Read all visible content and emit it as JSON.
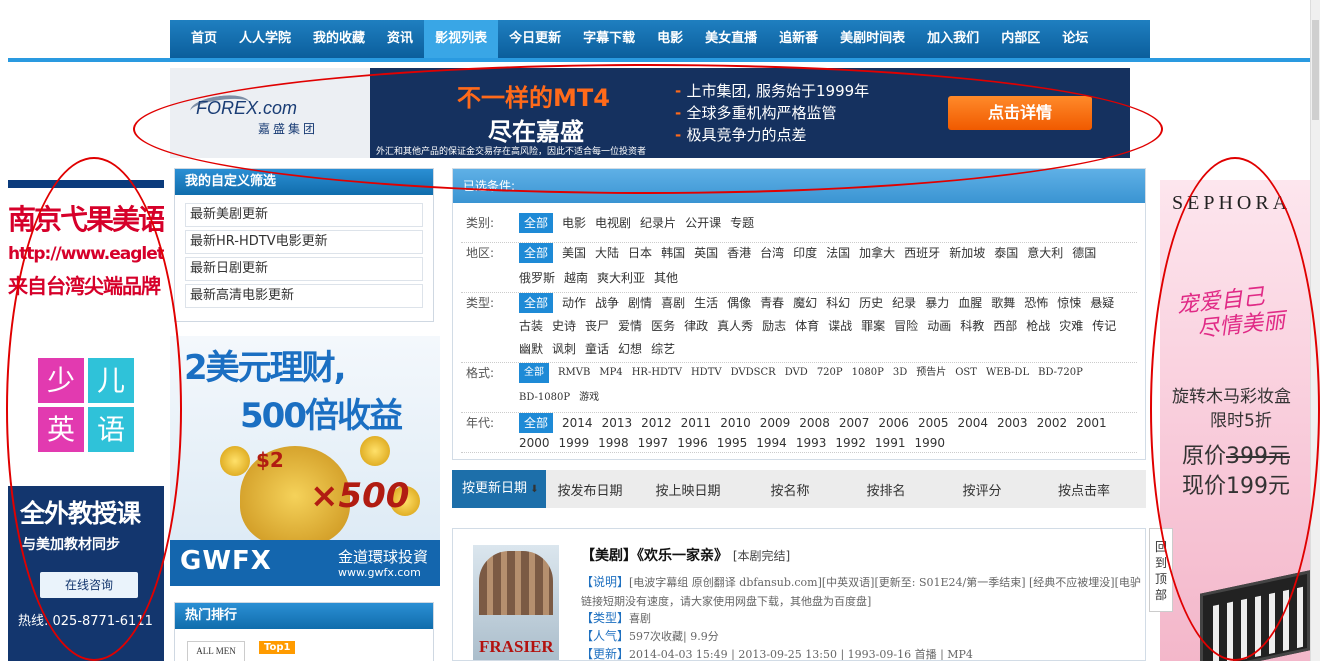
{
  "nav": [
    "首页",
    "人人学院",
    "我的收藏",
    "资讯",
    "影视列表",
    "今日更新",
    "字幕下载",
    "电影",
    "美女直播",
    "追新番",
    "美剧时间表",
    "加入我们",
    "内部区",
    "论坛"
  ],
  "nav_active": "影视列表",
  "forex": {
    "logo": "FOREX",
    "logo_suffix": ".com",
    "logo_sub": "嘉盛集团",
    "headline1": "不一样的MT4",
    "headline2": "尽在嘉盛",
    "bullets": [
      "上市集团, 服务始于1999年",
      "全球多重机构严格监管",
      "极具竞争力的点差"
    ],
    "button": "点击详情",
    "disclaimer": "外汇和其他产品的保证金交易存在高风险，因此不适合每一位投资者"
  },
  "left_ad": {
    "line1": "南京弋果美语",
    "line2": "http://www.eagletw.cn",
    "line3": "来自台湾尖端品牌",
    "chars": [
      "少",
      "儿",
      "英",
      "语"
    ],
    "b1": "全外教授课",
    "b2": "与美加教材同步",
    "b3": "在线咨询",
    "b4": "热线: 025-8771-6111"
  },
  "right_ad": {
    "brand": "SEPHORA",
    "script": [
      "宠爱自己",
      "尽情美丽"
    ],
    "r1": "旋转木马彩妆盒",
    "r2": "限时5折",
    "r3_prefix": "原价",
    "r3_price": "399元",
    "r4": "现价199元"
  },
  "custom": {
    "title": "我的自定义筛选",
    "items": [
      "最新美剧更新",
      "最新HR-HDTV电影更新",
      "最新日剧更新",
      "最新高清电影更新"
    ]
  },
  "mid_ad": {
    "m1": "2美元理财,",
    "m2": "500倍收益",
    "x2": "$2",
    "x500": "×500",
    "brand": "GWFX",
    "cn": "金道環球投資",
    "url": "www.gwfx.com"
  },
  "hot": {
    "title": "热门排行",
    "thumb": "ALL MEN",
    "badge": "Top1"
  },
  "filter": {
    "header": "已选条件:",
    "rows": [
      {
        "label": "类别:",
        "opts": [
          "全部",
          "电影",
          "电视剧",
          "纪录片",
          "公开课",
          "专题"
        ]
      },
      {
        "label": "地区:",
        "opts": [
          "全部",
          "美国",
          "大陆",
          "日本",
          "韩国",
          "英国",
          "香港",
          "台湾",
          "印度",
          "法国",
          "加拿大",
          "西班牙",
          "新加坡",
          "泰国",
          "意大利",
          "德国",
          "俄罗斯",
          "越南",
          "爽大利亚",
          "其他"
        ]
      },
      {
        "label": "类型:",
        "opts": [
          "全部",
          "动作",
          "战争",
          "剧情",
          "喜剧",
          "生活",
          "偶像",
          "青春",
          "魔幻",
          "科幻",
          "历史",
          "纪录",
          "暴力",
          "血腥",
          "歌舞",
          "恐怖",
          "惊悚",
          "悬疑",
          "古装",
          "史诗",
          "丧尸",
          "爱情",
          "医务",
          "律政",
          "真人秀",
          "励志",
          "体育",
          "谍战",
          "罪案",
          "冒险",
          "动画",
          "科教",
          "西部",
          "枪战",
          "灾难",
          "传记",
          "幽默",
          "讽刺",
          "童话",
          "幻想",
          "综艺"
        ]
      },
      {
        "label": "格式:",
        "opts": [
          "全部",
          "RMVB",
          "MP4",
          "HR-HDTV",
          "HDTV",
          "DVDSCR",
          "DVD",
          "720P",
          "1080P",
          "3D",
          "预告片",
          "OST",
          "WEB-DL",
          "BD-720P",
          "BD-1080P",
          "游戏"
        ]
      },
      {
        "label": "年代:",
        "opts": [
          "全部",
          "2014",
          "2013",
          "2012",
          "2011",
          "2010",
          "2009",
          "2008",
          "2007",
          "2006",
          "2005",
          "2004",
          "2003",
          "2002",
          "2001",
          "2000",
          "1999",
          "1998",
          "1997",
          "1996",
          "1995",
          "1994",
          "1993",
          "1992",
          "1991",
          "1990"
        ]
      }
    ]
  },
  "sort": [
    "按更新日期",
    "按发布日期",
    "按上映日期",
    "按名称",
    "按排名",
    "按评分",
    "按点击率"
  ],
  "item": {
    "title": "【美剧】《欢乐一家亲》",
    "status": "[本剧完结]",
    "poster_text": "FRASIER",
    "desc_label": "【说明】",
    "desc": "[电波字幕组 原创翻译 dbfansub.com][中英双语][更新至: S01E24/第一季结束] [经典不应被埋没][电驴链接短期没有速度，请大家使用网盘下载，其他盘为百度盘]",
    "type_label": "【类型】",
    "type": "喜剧",
    "pop_label": "【人气】",
    "pop": "597次收藏| 9.9分",
    "upd_label": "【更新】",
    "upd": "2014-04-03 15:49 | 2013-09-25 13:50 | 1993-09-16 首播 | MP4"
  },
  "backtop": "回到顶部"
}
